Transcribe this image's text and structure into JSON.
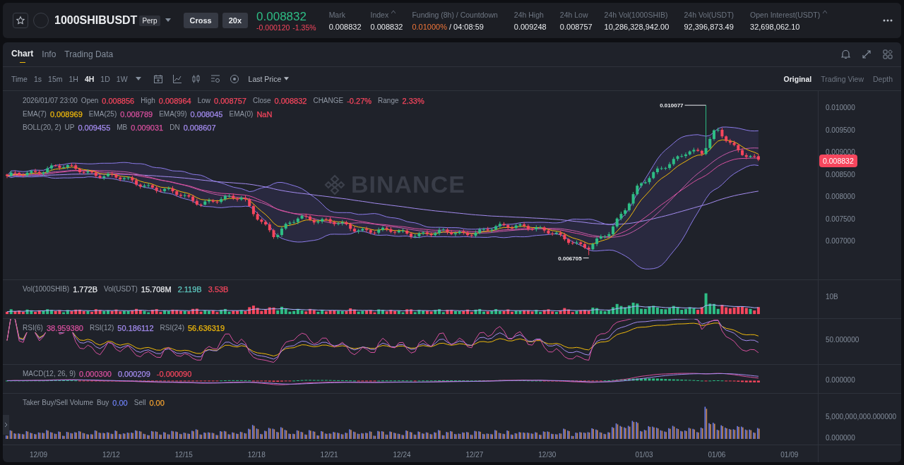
{
  "header": {
    "symbol": "1000SHIBUSDT",
    "contract_type": "Perp",
    "margin_mode": "Cross",
    "leverage": "20x",
    "last_price": "0.008832",
    "price_change": "-0.000120",
    "price_change_percent": "-1.35%",
    "stats": [
      {
        "kind": "plain",
        "label": "Mark",
        "value": "0.008832",
        "info": false
      },
      {
        "kind": "plain",
        "label": "Index",
        "value": "0.008832",
        "info": true
      },
      {
        "kind": "funding",
        "label": "Funding (8h) / Countdown",
        "rate": "0.01000%",
        "countdown": "/ 04:08:59",
        "info": false
      },
      {
        "kind": "plain",
        "label": "24h High",
        "value": "0.009248",
        "info": false
      },
      {
        "kind": "plain",
        "label": "24h Low",
        "value": "0.008757",
        "info": false
      },
      {
        "kind": "plain",
        "label": "24h Vol(1000SHIB)",
        "value": "10,286,328,942.00",
        "info": false
      },
      {
        "kind": "plain",
        "label": "24h Vol(USDT)",
        "value": "92,396,873.49",
        "info": false
      },
      {
        "kind": "plain",
        "label": "Open Interest(USDT)",
        "value": "32,698,062.10",
        "info": true
      }
    ]
  },
  "panel_tabs": [
    {
      "label": "Chart",
      "selected": true
    },
    {
      "label": "Info",
      "selected": false
    },
    {
      "label": "Trading Data",
      "selected": false
    }
  ],
  "toolbar": {
    "time_label": "Time",
    "intervals": [
      {
        "label": "1s",
        "selected": false
      },
      {
        "label": "15m",
        "selected": false
      },
      {
        "label": "1H",
        "selected": false
      },
      {
        "label": "4H",
        "selected": true
      },
      {
        "label": "1D",
        "selected": false
      },
      {
        "label": "1W",
        "selected": false
      }
    ],
    "price_source": "Last Price"
  },
  "views": [
    {
      "label": "Original",
      "selected": true
    },
    {
      "label": "Trading View",
      "selected": false
    },
    {
      "label": "Depth",
      "selected": false
    }
  ],
  "main_chart": {
    "legend_rows": [
      [
        {
          "label": "2026/01/07 23:00"
        },
        {
          "label": "Open",
          "value": "0.008856",
          "color": "#f6465d"
        },
        {
          "label": "High",
          "value": "0.008964",
          "color": "#f6465d"
        },
        {
          "label": "Low",
          "value": "0.008757",
          "color": "#f6465d"
        },
        {
          "label": "Close",
          "value": "0.008832",
          "color": "#f6465d"
        },
        {
          "label": "CHANGE",
          "value": "-0.27%",
          "color": "#f6465d"
        },
        {
          "label": "Range",
          "value": "2.33%",
          "color": "#f6465d"
        }
      ],
      [
        {
          "label": "EMA(7)",
          "value": "0.008969",
          "color": "#f0b90b"
        },
        {
          "label": "EMA(25)",
          "value": "0.008789",
          "color": "#d9509f"
        },
        {
          "label": "EMA(99)",
          "value": "0.008045",
          "color": "#a48cf0"
        },
        {
          "label": "EMA(0)",
          "value": "NaN",
          "color": "#f6465d"
        }
      ],
      [
        {
          "label": "BOLL(20, 2)"
        },
        {
          "label": "UP",
          "value": "0.009455",
          "color": "#a48cf0"
        },
        {
          "label": "MB",
          "value": "0.009031",
          "color": "#d9509f"
        },
        {
          "label": "DN",
          "value": "0.008607",
          "color": "#a48cf0"
        }
      ]
    ],
    "watermark": "BINANCE",
    "price_ticks": [
      "0.010000",
      "0.009500",
      "0.009000",
      "0.008500",
      "0.008000",
      "0.007500",
      "0.007000"
    ],
    "current_price": "0.008832",
    "high_marker": "0.010077",
    "low_marker": "0.006705"
  },
  "volume_pane": {
    "legend": [
      {
        "label": "Vol(1000SHIB)",
        "value": "1.772B",
        "color": "#eaecef"
      },
      {
        "label": "Vol(USDT)",
        "value": "15.708M",
        "color": "#eaecef"
      },
      {
        "value": "2.119B",
        "color": "#5fc9c0"
      },
      {
        "value": "3.53B",
        "color": "#f6465d"
      }
    ],
    "ticks": [
      "10B"
    ]
  },
  "rsi_pane": {
    "legend": [
      {
        "label": "RSI(6)",
        "value": "38.959380",
        "color": "#d9509f"
      },
      {
        "label": "RSI(12)",
        "value": "50.186112",
        "color": "#a48cf0"
      },
      {
        "label": "RSI(24)",
        "value": "56.636319",
        "color": "#f0b90b"
      }
    ],
    "ticks": [
      "50.000000"
    ]
  },
  "macd_pane": {
    "legend": [
      {
        "label": "MACD(12, 26, 9)"
      },
      {
        "value": "0.000300",
        "color": "#d9509f"
      },
      {
        "value": "0.000209",
        "color": "#a48cf0"
      },
      {
        "value": "-0.000090",
        "color": "#f6465d"
      }
    ],
    "ticks": [
      "0.000000"
    ]
  },
  "taker_pane": {
    "legend": [
      {
        "label": "Taker Buy/Sell Volume"
      },
      {
        "label": "Buy",
        "value": "0.00",
        "color": "#6c7ff0"
      },
      {
        "label": "Sell",
        "value": "0.00",
        "color": "#f0a030"
      }
    ],
    "ticks": [
      "5,000,000,000.000000",
      "0.000000"
    ]
  },
  "time_axis": [
    "12/09",
    "12/12",
    "12/15",
    "12/18",
    "12/21",
    "12/24",
    "12/27",
    "12/30",
    "01/03",
    "01/06",
    "01/09"
  ]
}
